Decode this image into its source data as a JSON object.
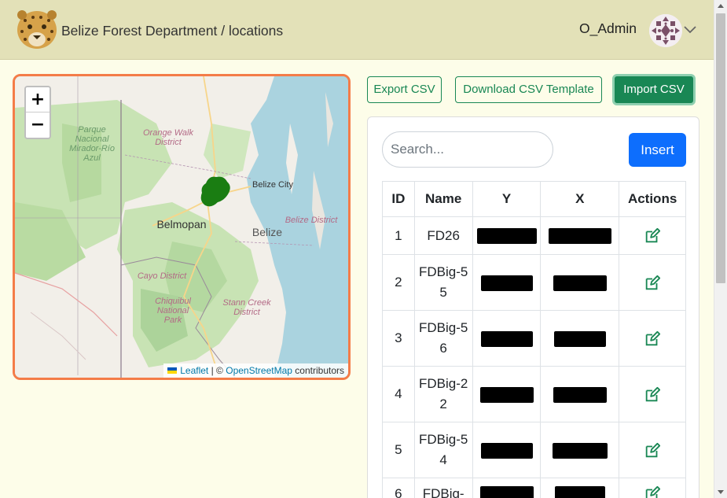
{
  "header": {
    "title": "Belize Forest Department / locations",
    "username": "O_Admin"
  },
  "map": {
    "zoom_in": "+",
    "zoom_out": "−",
    "attribution_leaflet": "Leaflet",
    "attribution_sep": "| ©",
    "attribution_osm": "OpenStreetMap",
    "attribution_tail": "contributors",
    "labels": {
      "parque": "Parque Nacional Mirador-Río Azul",
      "orange_walk": "Orange Walk District",
      "belize_city": "Belize City",
      "belmopan": "Belmopan",
      "belize": "Belize",
      "belize_district": "Belize District",
      "cayo": "Cayo District",
      "chiquibul": "Chiquibul National Park",
      "stann_creek": "Stann Creek District"
    },
    "marker_color": "#1a7d12"
  },
  "toolbar": {
    "export_label": "Export CSV",
    "template_label": "Download CSV Template",
    "import_label": "Import CSV"
  },
  "search": {
    "placeholder": "Search..."
  },
  "insert_label": "Insert",
  "table": {
    "headers": [
      "ID",
      "Name",
      "Y",
      "X",
      "Actions"
    ],
    "rows": [
      {
        "id": "1",
        "name": "FD26"
      },
      {
        "id": "2",
        "name": "FDBig-55"
      },
      {
        "id": "3",
        "name": "FDBig-56"
      },
      {
        "id": "4",
        "name": "FDBig-22"
      },
      {
        "id": "5",
        "name": "FDBig-54"
      },
      {
        "id": "6",
        "name": "FDBig-"
      }
    ]
  },
  "colors": {
    "header_bg": "#e3e1b8",
    "page_bg": "#fdfde9",
    "success": "#198754",
    "primary": "#0d6efd",
    "map_border": "#f47c48"
  },
  "icons": [
    "jaguar-logo-icon",
    "avatar-pattern-icon",
    "chevron-down-icon",
    "edit-icon"
  ]
}
